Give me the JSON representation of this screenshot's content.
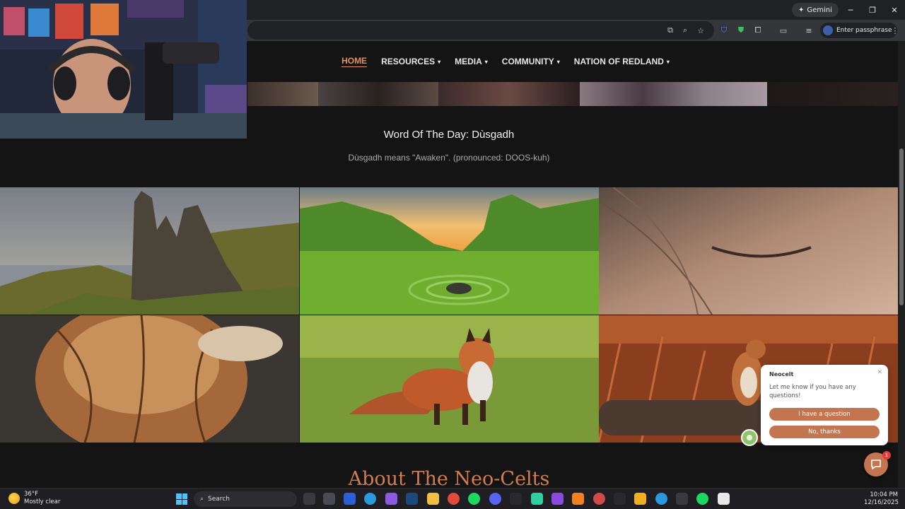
{
  "browser": {
    "gemini_label": "Gemini",
    "profile_label": "Enter passphrase",
    "window_controls": [
      "minimize-icon",
      "maximize-icon",
      "close-icon"
    ]
  },
  "nav": {
    "items": [
      {
        "label": "HOME",
        "active": true
      },
      {
        "label": "RESOURCES",
        "dropdown": true
      },
      {
        "label": "MEDIA",
        "dropdown": true
      },
      {
        "label": "COMMUNITY",
        "dropdown": true
      },
      {
        "label": "NATION OF REDLAND",
        "dropdown": true
      }
    ],
    "active_color": "#e0915e"
  },
  "word_of_day": {
    "title": "Word Of The Day: Dùsgadh",
    "text": "Dùsgadh means \"Awaken\". (pronounced: DOOS-kuh)"
  },
  "gallery": {
    "images": [
      "rock-pinnacles-landscape",
      "green-valley-stone-circle",
      "closed-eye-freckles",
      "highland-cow-hair",
      "red-fox-grass",
      "red-squirrel-log"
    ]
  },
  "about": {
    "heading": "About The Neo-Celts"
  },
  "chat": {
    "name": "Neocelt",
    "message": "Let me know if you have any questions!",
    "button_question": "I have a question",
    "button_no": "No, thanks",
    "badge_count": "1",
    "accent": "#c37550"
  },
  "taskbar": {
    "weather_temp": "36°F",
    "weather_desc": "Mostly clear",
    "search_label": "Search",
    "time": "10:04 PM",
    "date": "12/16/2025"
  }
}
